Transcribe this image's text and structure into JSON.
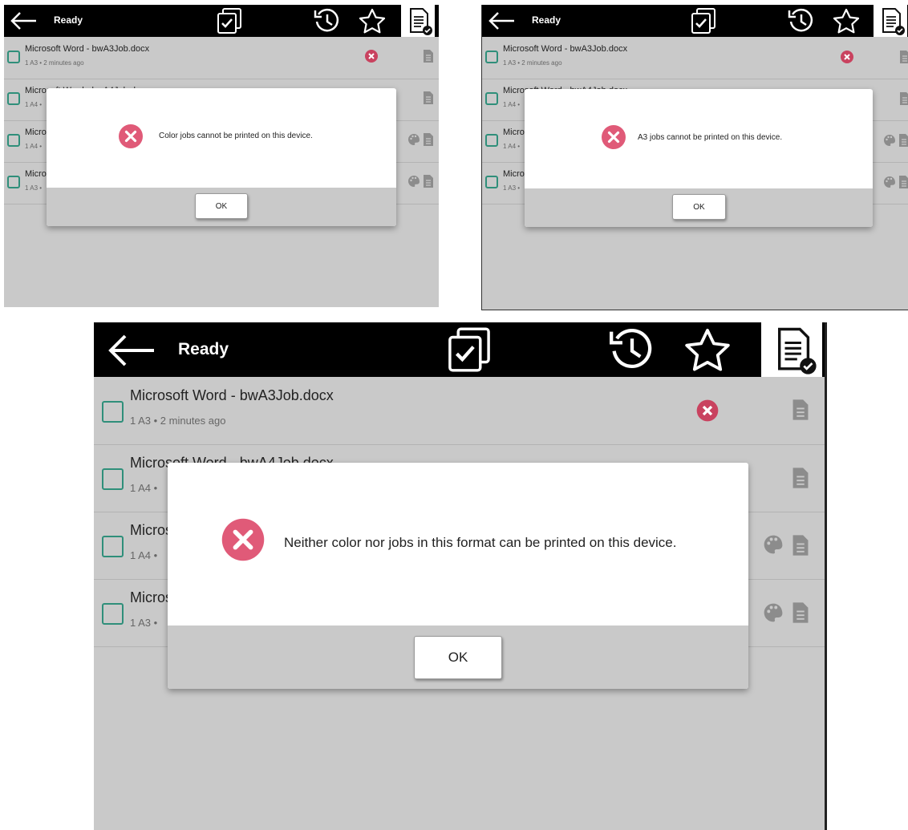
{
  "status_text": "Ready",
  "ok_label": "OK",
  "colors": {
    "topbar": "#000000",
    "error": "#e05a78",
    "checkbox": "#2f8f7a",
    "footer": "#c9c9c9"
  },
  "icons": {
    "back": "back-arrow-icon",
    "select_all": "select-all-icon",
    "history": "history-icon",
    "favorites": "star-icon",
    "jobs": "document-check-icon",
    "error": "error-icon",
    "document": "document-icon",
    "color": "palette-icon"
  },
  "jobs": [
    {
      "title": "Microsoft Word - bwA3Job.docx",
      "meta": "1 A3 • 2 minutes ago"
    },
    {
      "title": "Microsoft Word - bwA4Job.docx",
      "meta": "1 A4 •"
    },
    {
      "title": "Micros",
      "meta": "1 A4 •"
    },
    {
      "title": "Micros",
      "meta": "1 A3 •"
    }
  ],
  "dialogs": [
    {
      "message": "Color jobs cannot be printed on this device."
    },
    {
      "message": "A3 jobs cannot be printed on this device."
    },
    {
      "message": "Neither color nor jobs in this format can be printed on this device."
    }
  ]
}
